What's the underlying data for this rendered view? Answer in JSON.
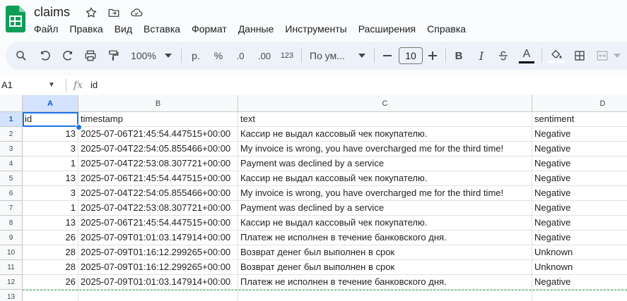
{
  "app": {
    "doc_title": "claims",
    "menu": [
      "Файл",
      "Правка",
      "Вид",
      "Вставка",
      "Формат",
      "Данные",
      "Инструменты",
      "Расширения",
      "Справка"
    ]
  },
  "toolbar": {
    "zoom": "100%",
    "currency": "р.",
    "percent": "%",
    "dec_decrease": ".0",
    "dec_increase": ".00",
    "number_format": "123",
    "font_name": "По ум...",
    "font_size": "10",
    "bold": "B",
    "italic": "I",
    "text_color_letter": "A"
  },
  "formula_bar": {
    "name_box": "A1",
    "fx": "fx",
    "value": "id"
  },
  "grid": {
    "columns": [
      "A",
      "B",
      "C",
      "D"
    ],
    "selected_column": "A",
    "selected_row": "1",
    "row_numbers": [
      "1",
      "2",
      "3",
      "4",
      "5",
      "6",
      "7",
      "8",
      "9",
      "10",
      "11",
      "12",
      "13"
    ],
    "header_row": [
      "id",
      "timestamp",
      "text",
      "sentiment"
    ],
    "rows": [
      [
        "13",
        "2025-07-06T21:45:54.447515+00:00",
        "Кассир не выдал кассовый чек покупателю.",
        "Negative"
      ],
      [
        "3",
        "2025-07-04T22:54:05.855466+00:00",
        "My invoice is wrong, you have overcharged me for the third time!",
        "Negative"
      ],
      [
        "1",
        "2025-07-04T22:53:08.307721+00:00",
        "Payment was declined by a service",
        "Negative"
      ],
      [
        "13",
        "2025-07-06T21:45:54.447515+00:00",
        "Кассир не выдал кассовый чек покупателю.",
        "Negative"
      ],
      [
        "3",
        "2025-07-04T22:54:05.855466+00:00",
        "My invoice is wrong, you have overcharged me for the third time!",
        "Negative"
      ],
      [
        "1",
        "2025-07-04T22:53:08.307721+00:00",
        "Payment was declined by a service",
        "Negative"
      ],
      [
        "13",
        "2025-07-06T21:45:54.447515+00:00",
        "Кассир не выдал кассовый чек покупателю.",
        "Negative"
      ],
      [
        "26",
        "2025-07-09T01:01:03.147914+00:00",
        "Платеж не исполнен в течение банковского дня.",
        "Negative"
      ],
      [
        "28",
        "2025-07-09T01:16:12.299265+00:00",
        "Возврат денег был выполнен в срок",
        "Unknown"
      ],
      [
        "28",
        "2025-07-09T01:16:12.299265+00:00",
        "Возврат денег был выполнен в срок",
        "Unknown"
      ],
      [
        "26",
        "2025-07-09T01:01:03.147914+00:00",
        "Платеж не исполнен в течение банковского дня.",
        "Negative"
      ]
    ]
  },
  "colors": {
    "accent": "#1a73e8",
    "sheets_green": "#0f9d58",
    "toolbar_bg": "#edf2fa",
    "selected_header": "#d3e3fd"
  }
}
